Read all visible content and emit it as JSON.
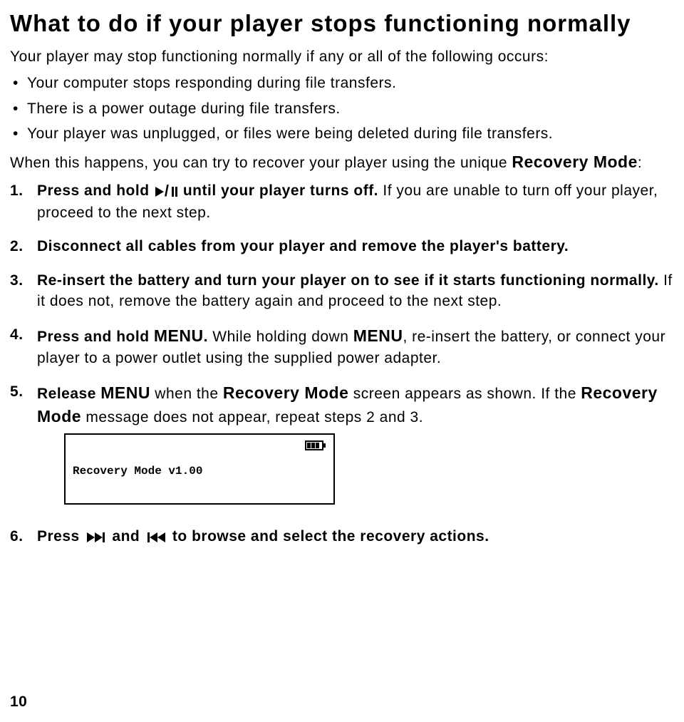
{
  "title": "What to do if your player stops functioning normally",
  "intro": "Your player may stop functioning normally if any or all of the following occurs:",
  "bullets": [
    "Your computer stops responding during file transfers.",
    "There is a power outage during file transfers.",
    "Your player was unplugged, or files were being deleted during file transfers."
  ],
  "lead_in_a": "When this happens, you can try to recover your player using the unique ",
  "lead_in_b": "Recovery Mode",
  "lead_in_c": ":",
  "steps": {
    "s1a": "Press and hold ",
    "s1b": " until your player turns off. ",
    "s1c": "If you are unable to turn off your player, proceed to the next step.",
    "s2": "Disconnect all cables from your player and remove the player's battery.",
    "s3a": "Re-insert the battery and turn your player on to see if it starts functioning normally. ",
    "s3b": "If it does not, remove the battery again and proceed to the next step.",
    "s4a": "Press and hold ",
    "s4menu": "MENU",
    "s4b": ". ",
    "s4c": "While holding down ",
    "s4d": ", re-insert the battery, or connect your player to a power outlet using the supplied power adapter.",
    "s5a": "Release ",
    "s5b": " when the ",
    "s5rm": "Recovery Mode",
    "s5c": " screen appears as shown. ",
    "s5d": "If the ",
    "s5e": " message does not appear, repeat steps 2 and 3.",
    "s6a": "Press ",
    "s6b": " and ",
    "s6c": " to browse and select the recovery actions."
  },
  "screen_label": "Recovery Mode v1.00",
  "page_number": "10"
}
